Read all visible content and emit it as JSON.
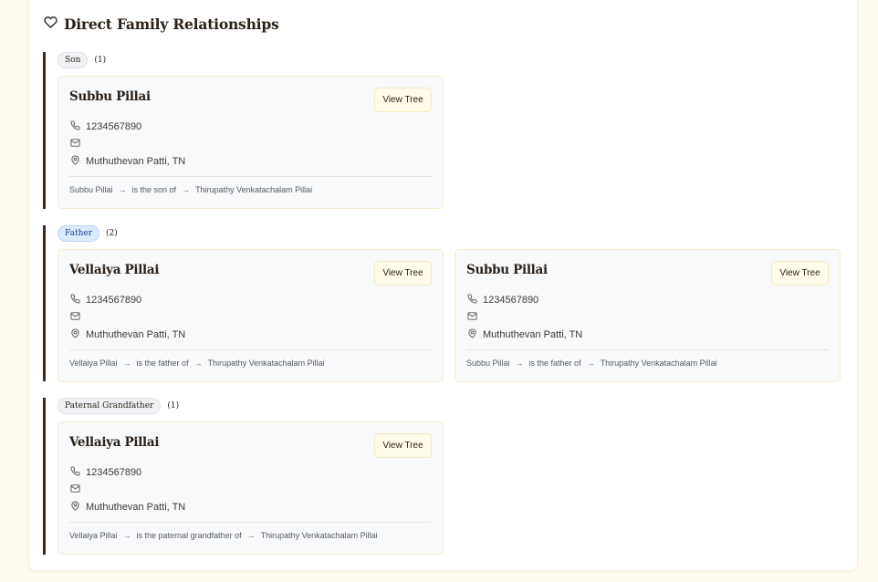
{
  "section": {
    "title": "Direct Family Relationships",
    "icon": "heart-icon"
  },
  "groups": [
    {
      "badge": "Son",
      "badge_color": "#f1f2f5",
      "count": "(1)",
      "cards": [
        {
          "name": "Subbu Pillai",
          "button": "View Tree",
          "phone": "1234567890",
          "email": "",
          "location": "Muthuthevan Patti, TN",
          "rel_from": "Subbu Pillai",
          "rel_text": "is the son of",
          "rel_to": "Thirupathy Venkatachalam Pillai"
        }
      ]
    },
    {
      "badge": "Father",
      "badge_color": "#dbeafe",
      "count": "(2)",
      "cards": [
        {
          "name": "Vellaiya Pillai",
          "button": "View Tree",
          "phone": "1234567890",
          "email": "",
          "location": "Muthuthevan Patti, TN",
          "rel_from": "Vellaiya Pillai",
          "rel_text": "is the father of",
          "rel_to": "Thirupathy Venkatachalam Pillai"
        },
        {
          "name": "Subbu Pillai",
          "button": "View Tree",
          "phone": "1234567890",
          "email": "",
          "location": "Muthuthevan Patti, TN",
          "rel_from": "Subbu Pillai",
          "rel_text": "is the father of",
          "rel_to": "Thirupathy Venkatachalam Pillai"
        }
      ]
    },
    {
      "badge": "Paternal Grandfather",
      "badge_color": "#f1f2f5",
      "count": "(1)",
      "cards": [
        {
          "name": "Vellaiya Pillai",
          "button": "View Tree",
          "phone": "1234567890",
          "email": "",
          "location": "Muthuthevan Patti, TN",
          "rel_from": "Vellaiya Pillai",
          "rel_text": "is the paternal grandfather of",
          "rel_to": "Thirupathy Venkatachalam Pillai"
        }
      ]
    }
  ],
  "arrow_glyph": "→"
}
